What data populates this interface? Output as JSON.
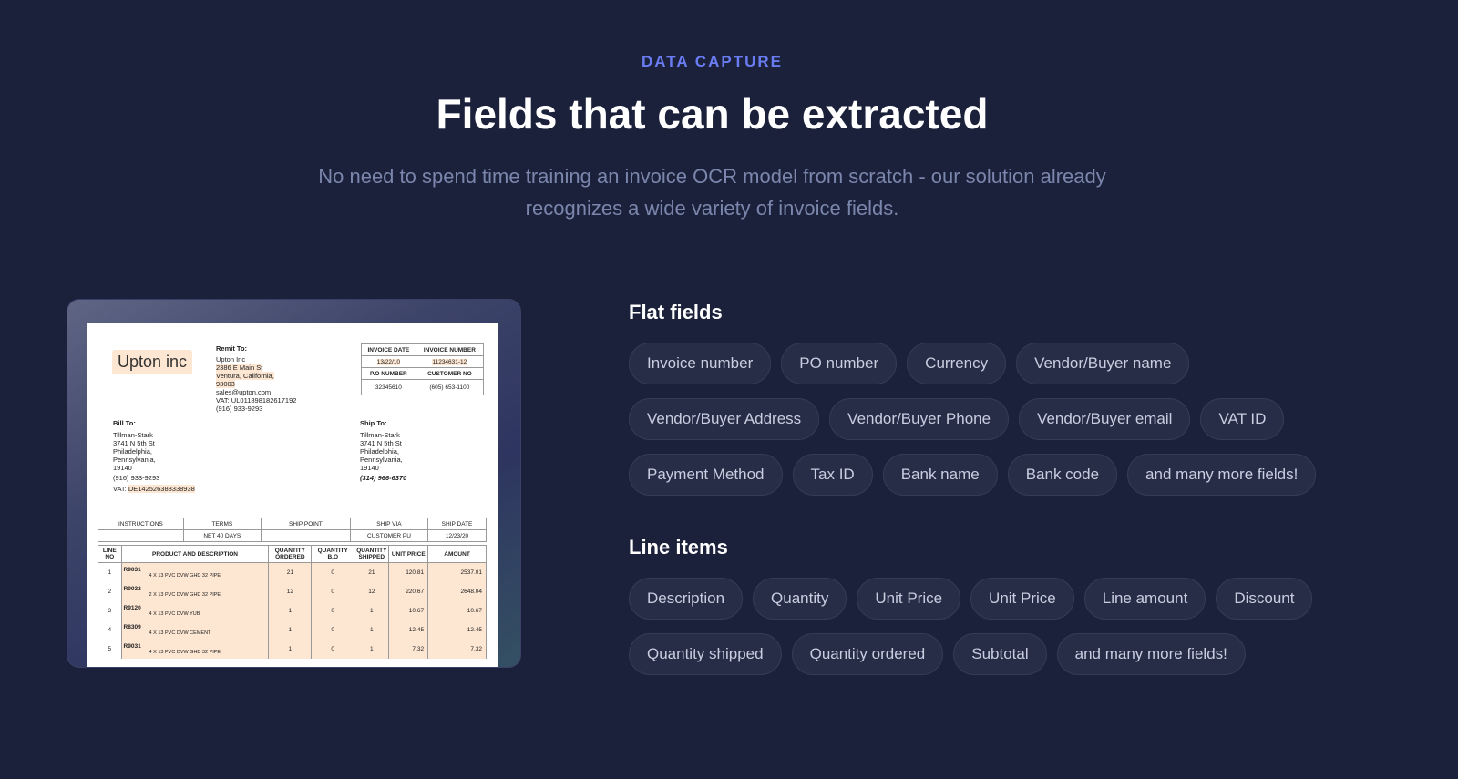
{
  "header": {
    "eyebrow": "DATA CAPTURE",
    "title": "Fields that can be extracted",
    "subtitle": "No need to spend time training an invoice OCR model from scratch - our solution already recognizes a wide variety of invoice fields."
  },
  "invoice": {
    "company_logo": "Upton inc",
    "remit_to_label": "Remit To:",
    "remit_lines": [
      "Upton Inc",
      "2386 E Main St",
      "Ventura, California,",
      "93003",
      "sales@upton.com",
      "VAT: UL011898182617192",
      "(916) 933-9293"
    ],
    "invoice_date_label": "INVOICE DATE",
    "invoice_date": "13/22/10",
    "invoice_number_label": "INVOICE NUMBER",
    "invoice_number": "11234631-12",
    "po_number_label": "P.O NUMBER",
    "po_number": "32345610",
    "customer_no_label": "CUSTOMER NO",
    "customer_no": "(605) 653-1100",
    "bill_to_label": "Bill To:",
    "bill_lines": [
      "Tillman-Stark",
      "3741 N 5th St",
      "Philadelphia,",
      "Pennsylvania,",
      "19140",
      "(916) 933-9293"
    ],
    "bill_vat_prefix": "VAT:",
    "bill_vat": "DE142526388338938",
    "ship_to_label": "Ship To:",
    "ship_lines": [
      "Tillman-Stark",
      "3741 N 5th St",
      "Philadelphia,",
      "Pennsylvania,",
      "19140"
    ],
    "ship_phone": "(314) 966-6370",
    "terms_headers": [
      "INSTRUCTIONS",
      "TERMS",
      "SHIP POINT",
      "SHIP VIA",
      "SHIP DATE"
    ],
    "terms_values": [
      "",
      "NET 40 DAYS",
      "",
      "CUSTOMER PU",
      "12/23/20"
    ],
    "line_headers": [
      "LINE NO",
      "PRODUCT AND DESCRIPTION",
      "QUANTITY ORDERED",
      "QUANTITY B.O",
      "QUANTITY SHIPPED",
      "UNIT PRICE",
      "AMOUNT"
    ],
    "lines": [
      {
        "no": "1",
        "code": "R9031",
        "desc": "4 X 13 PVC DVW GHD 32 PIPE",
        "ordered": "21",
        "bo": "0",
        "shipped": "21",
        "price": "120.81",
        "amount": "2537.01"
      },
      {
        "no": "2",
        "code": "R9032",
        "desc": "2 X 13 PVC DVW GHD 32 PIPE",
        "ordered": "12",
        "bo": "0",
        "shipped": "12",
        "price": "220.67",
        "amount": "2648.04"
      },
      {
        "no": "3",
        "code": "R9120",
        "desc": "4 X 13 PVC DVW YUB",
        "ordered": "1",
        "bo": "0",
        "shipped": "1",
        "price": "10.67",
        "amount": "10.67"
      },
      {
        "no": "4",
        "code": "R8309",
        "desc": "4 X 13 PVC DVW CEMENT",
        "ordered": "1",
        "bo": "0",
        "shipped": "1",
        "price": "12.45",
        "amount": "12.45"
      },
      {
        "no": "5",
        "code": "R9031",
        "desc": "4 X 13 PVC DVW GHD 32 PIPE",
        "ordered": "1",
        "bo": "0",
        "shipped": "1",
        "price": "7.32",
        "amount": "7.32"
      }
    ]
  },
  "flat_fields": {
    "title": "Flat fields",
    "chips": [
      "Invoice number",
      "PO number",
      "Currency",
      "Vendor/Buyer name",
      "Vendor/Buyer Address",
      "Vendor/Buyer Phone",
      "Vendor/Buyer email",
      "VAT ID",
      "Payment Method",
      "Tax ID",
      "Bank name",
      "Bank code",
      "and many more fields!"
    ]
  },
  "line_items": {
    "title": "Line items",
    "chips": [
      "Description",
      "Quantity",
      "Unit Price",
      "Unit Price",
      "Line amount",
      "Discount",
      "Quantity shipped",
      "Quantity ordered",
      "Subtotal",
      "and many more fields!"
    ]
  }
}
